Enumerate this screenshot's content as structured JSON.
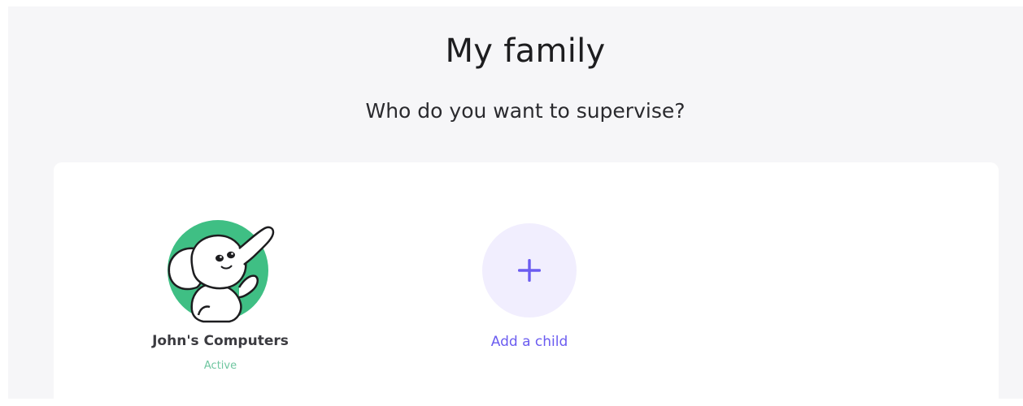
{
  "header": {
    "title": "My family",
    "subtitle": "Who do you want to supervise?"
  },
  "profiles": [
    {
      "name": "John's Computers",
      "status": "Active",
      "avatar_icon": "elephant-icon"
    }
  ],
  "add_child": {
    "label": "Add a child",
    "icon": "plus-icon"
  },
  "colors": {
    "page_background": "#f6f6f8",
    "card_background": "#ffffff",
    "accent": "#6b5cf0",
    "status_active": "#6fc6a0",
    "avatar_green": "#3fbf84"
  }
}
